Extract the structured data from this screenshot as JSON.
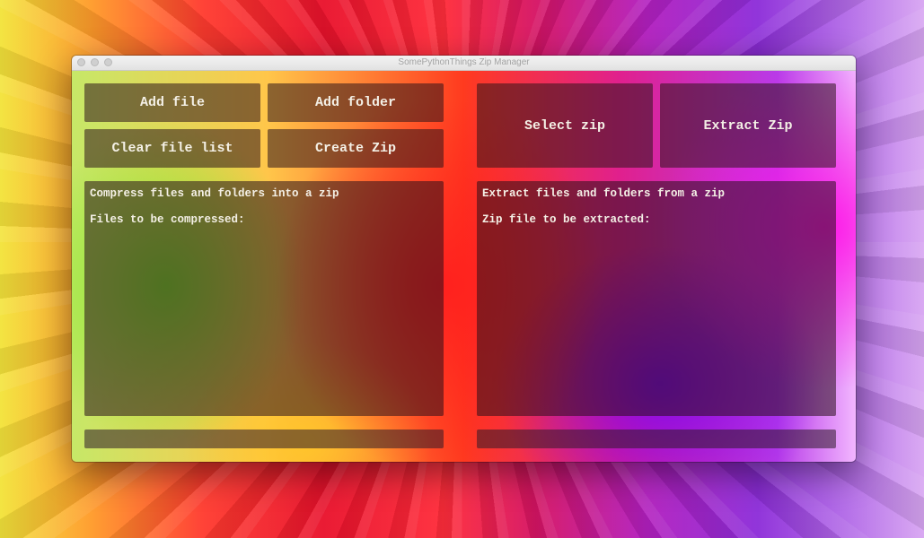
{
  "window": {
    "title": "SomePythonThings Zip Manager"
  },
  "compress": {
    "add_file_label": "Add file",
    "add_folder_label": "Add folder",
    "clear_list_label": "Clear file list",
    "create_zip_label": "Create Zip",
    "panel_heading": "Compress files and folders into a zip",
    "panel_files_label": "Files to be compressed:",
    "progress": 0
  },
  "extract": {
    "select_zip_label": "Select zip",
    "extract_zip_label": "Extract Zip",
    "panel_heading": "Extract files and folders from a zip",
    "panel_zip_label": "Zip file to be extracted:",
    "progress": 0
  },
  "icons": {
    "window_buttons": [
      "close-icon",
      "minimize-icon",
      "zoom-icon"
    ]
  }
}
